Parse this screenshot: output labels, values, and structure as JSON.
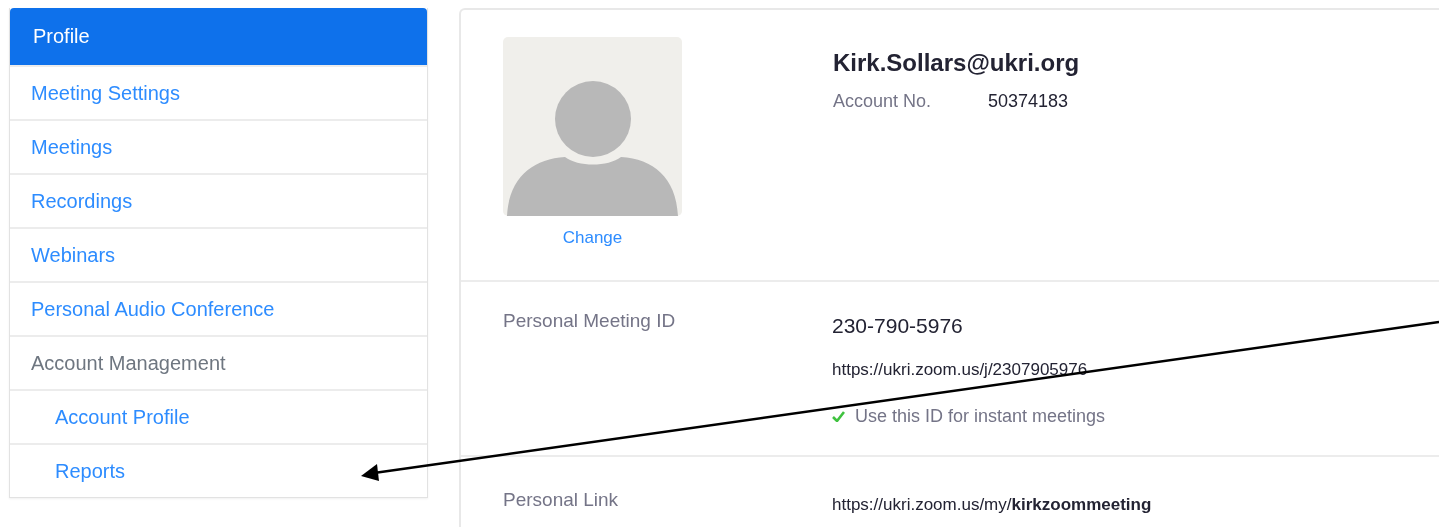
{
  "sidebar": {
    "items": [
      {
        "label": "Profile",
        "kind": "link",
        "selected": true
      },
      {
        "label": "Meeting Settings",
        "kind": "link",
        "selected": false
      },
      {
        "label": "Meetings",
        "kind": "link",
        "selected": false
      },
      {
        "label": "Recordings",
        "kind": "link",
        "selected": false
      },
      {
        "label": "Webinars",
        "kind": "link",
        "selected": false
      },
      {
        "label": "Personal Audio Conference",
        "kind": "link",
        "selected": false
      },
      {
        "label": "Account Management",
        "kind": "heading",
        "selected": false
      },
      {
        "label": "Account Profile",
        "kind": "subitem",
        "selected": false
      },
      {
        "label": "Reports",
        "kind": "subitem",
        "selected": false
      }
    ]
  },
  "profile": {
    "change_link": "Change",
    "email": "Kirk.Sollars@ukri.org",
    "account_label": "Account No.",
    "account_number": "50374183"
  },
  "sections": [
    {
      "label": "Personal Meeting ID",
      "value": "230-790-5976",
      "url": "https://ukri.zoom.us/j/2307905976",
      "option": {
        "label": "Use this ID for instant meetings",
        "checked": true
      }
    },
    {
      "label": "Personal Link",
      "url": "https://ukri.zoom.us/my/**kirkzoommeeting**"
    }
  ]
}
